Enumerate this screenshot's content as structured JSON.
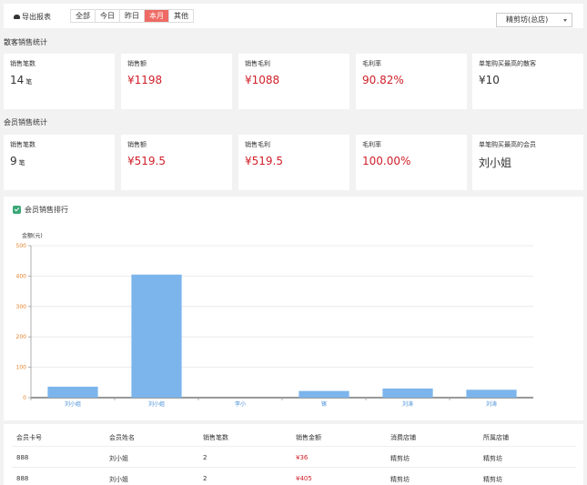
{
  "toolbar": {
    "export_label": "导出报表",
    "tabs": [
      "全部",
      "今日",
      "昨日",
      "本月",
      "其他"
    ],
    "active_tab": "本月",
    "store_select": "精剪坊(总店)"
  },
  "walkin": {
    "title": "散客销售统计",
    "cards": [
      {
        "label": "销售笔数",
        "value": "14",
        "unit": "笔"
      },
      {
        "label": "销售额",
        "value": "¥1198"
      },
      {
        "label": "销售毛利",
        "value": "¥1088"
      },
      {
        "label": "毛利率",
        "value": "90.82%"
      },
      {
        "label": "单笔购买最高的散客",
        "value": "¥10"
      }
    ]
  },
  "member": {
    "title": "会员销售统计",
    "cards": [
      {
        "label": "销售笔数",
        "value": "9",
        "unit": "笔"
      },
      {
        "label": "销售额",
        "value": "¥519.5"
      },
      {
        "label": "销售毛利",
        "value": "¥519.5"
      },
      {
        "label": "毛利率",
        "value": "100.00%"
      },
      {
        "label": "单笔购买最高的会员",
        "value": "刘小姐"
      }
    ]
  },
  "colors": {
    "accent": "#ef6a64",
    "money": "#d0202a",
    "bar": "#7cb5ec",
    "check": "#3aa776"
  },
  "chart_data": {
    "type": "bar",
    "legend": "会员销售排行",
    "ylabel": "金额(元)",
    "ylim": [
      0,
      500
    ],
    "yticks": [
      0,
      100,
      200,
      300,
      400,
      500
    ],
    "categories": [
      "刘小姐",
      "刘小姐",
      "李小",
      "镓",
      "刘涛",
      "刘涛"
    ],
    "values": [
      36,
      405,
      0,
      22,
      30,
      26
    ]
  },
  "table": {
    "headers": [
      "会员卡号",
      "会员姓名",
      "销售笔数",
      "销售金额",
      "消费店铺",
      "所属店铺"
    ],
    "rows": [
      [
        "888",
        "刘小姐",
        "2",
        "¥36",
        "精剪坊",
        "精剪坊"
      ],
      [
        "888",
        "刘小姐",
        "2",
        "¥405",
        "精剪坊",
        "精剪坊"
      ]
    ]
  }
}
